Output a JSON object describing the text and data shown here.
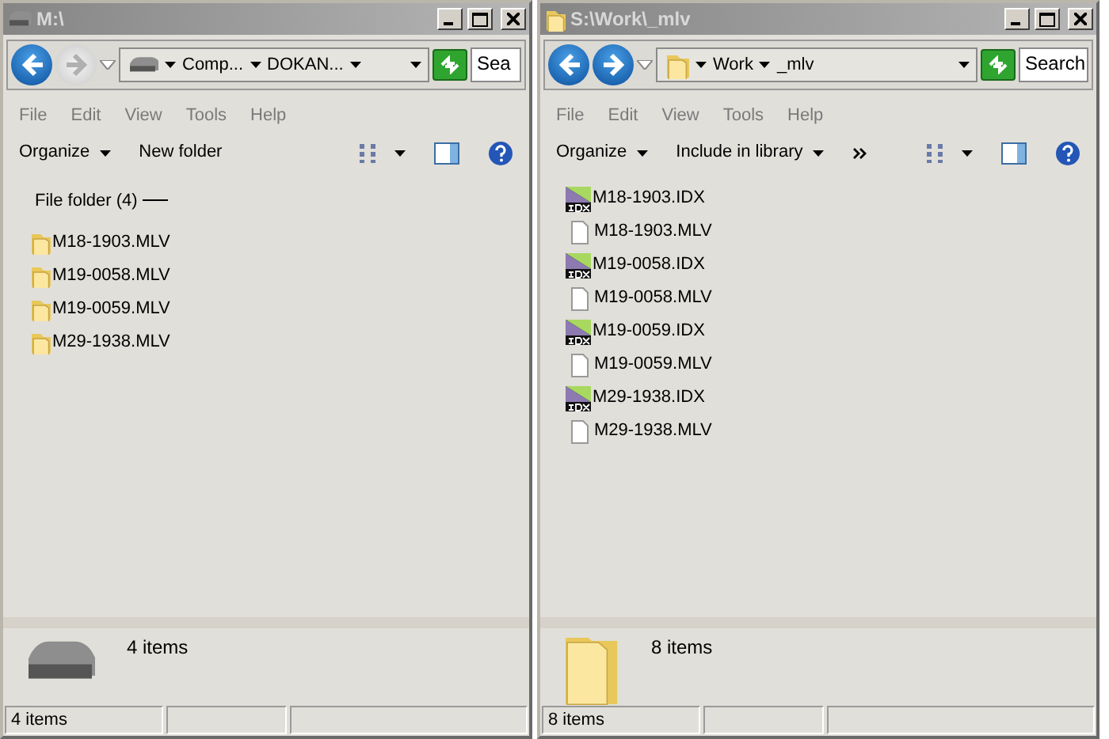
{
  "windows": [
    {
      "title": "M:\\",
      "kind": "drive",
      "back_enabled": true,
      "forward_enabled": false,
      "breadcrumb": [
        "Comp...",
        "DOKAN..."
      ],
      "search_placeholder": "Sea",
      "menu": [
        "File",
        "Edit",
        "View",
        "Tools",
        "Help"
      ],
      "toolbar": [
        {
          "label": "Organize",
          "dropdown": true
        },
        {
          "label": "New folder",
          "dropdown": false
        }
      ],
      "toolbar_more": false,
      "group_header": "File folder (4)",
      "files": [
        {
          "name": "M18-1903.MLV",
          "kind": "folder"
        },
        {
          "name": "M19-0058.MLV",
          "kind": "folder"
        },
        {
          "name": "M19-0059.MLV",
          "kind": "folder"
        },
        {
          "name": "M29-1938.MLV",
          "kind": "folder"
        }
      ],
      "details": "4 items",
      "status": "4 items"
    },
    {
      "title": "S:\\Work\\_mlv",
      "kind": "folder",
      "back_enabled": true,
      "forward_enabled": true,
      "breadcrumb": [
        "Work",
        "_mlv"
      ],
      "search_placeholder": "Search",
      "menu": [
        "File",
        "Edit",
        "View",
        "Tools",
        "Help"
      ],
      "toolbar": [
        {
          "label": "Organize",
          "dropdown": true
        },
        {
          "label": "Include in library",
          "dropdown": true
        }
      ],
      "toolbar_more": true,
      "files": [
        {
          "name": "M18-1903.IDX",
          "kind": "idx"
        },
        {
          "name": "M18-1903.MLV",
          "kind": "file"
        },
        {
          "name": "M19-0058.IDX",
          "kind": "idx"
        },
        {
          "name": "M19-0058.MLV",
          "kind": "file"
        },
        {
          "name": "M19-0059.IDX",
          "kind": "idx"
        },
        {
          "name": "M19-0059.MLV",
          "kind": "file"
        },
        {
          "name": "M29-1938.IDX",
          "kind": "idx"
        },
        {
          "name": "M29-1938.MLV",
          "kind": "file"
        }
      ],
      "details": "8 items",
      "status": "8 items"
    }
  ]
}
